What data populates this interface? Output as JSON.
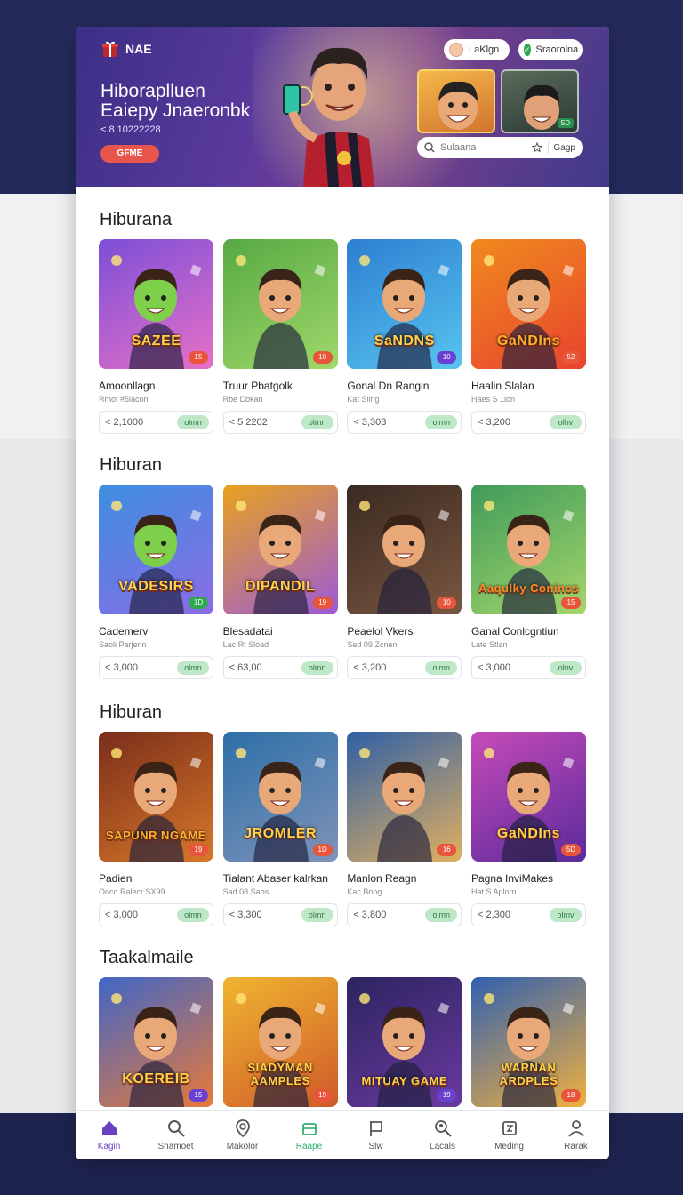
{
  "header": {
    "brand_name": "NAE",
    "title_line1": "Hiboraplluen",
    "title_line2": "Eaiepy Jnaeronbk",
    "subtitle": "< 8  10222228",
    "cta_label": "GFME",
    "login_label": "LaKlgn",
    "signup_label": "Sraorolna",
    "search_placeholder": "Sulaana",
    "search_right_label": "Gagp",
    "thumb_badge": "5D"
  },
  "sections": [
    {
      "title": "Hiburana",
      "cards": [
        {
          "title": "Amoonllagn",
          "meta": "Rmot #5lacon",
          "price": "< 2,1000",
          "chip": "olmn",
          "badge": "15",
          "art_text": "SAZEE",
          "icon": "green-monster-art"
        },
        {
          "title": "Truur Pbatgolk",
          "meta": "Rbe Dbkan",
          "price": "< 5 2202",
          "chip": "olmn",
          "badge": "10",
          "art_text": "",
          "icon": "friends-park-art"
        },
        {
          "title": "Gonal Dn Rangin",
          "meta": "Kat Sling",
          "price": "< 3,303",
          "chip": "olmn",
          "badge": "10",
          "art_text": "SaNDNS",
          "icon": "boy-hero-art"
        },
        {
          "title": "Haalin Slalan",
          "meta": "Haes S 1lon",
          "price": "< 3,200",
          "chip": "olhv",
          "badge": "52",
          "art_text": "GaNDIns",
          "icon": "guitar-boy-art"
        }
      ]
    },
    {
      "title": "Hiburan",
      "cards": [
        {
          "title": "Cademerv",
          "meta": "Saoli Parjenn",
          "price": "< 3,000",
          "chip": "olmn",
          "badge": "1D",
          "art_text": "VADESIRS",
          "icon": "boy-monster-art"
        },
        {
          "title": "Blesadatai",
          "meta": "Lac Rt Sload",
          "price": "< 63,00",
          "chip": "olmn",
          "badge": "19",
          "art_text": "DIPANDIL",
          "icon": "party-dragon-art"
        },
        {
          "title": "Peaelol Vkers",
          "meta": "Sed 09 Zcnen",
          "price": "< 3,200",
          "chip": "olmn",
          "badge": "10",
          "art_text": "",
          "icon": "girl-portrait-art"
        },
        {
          "title": "Ganal Conlcgntiun",
          "meta": "Late Stlan",
          "price": "< 3,000",
          "chip": "olnv",
          "badge": "15",
          "art_text": "Aaqulky Conincs",
          "icon": "red-car-art"
        }
      ]
    },
    {
      "title": "Hiburan",
      "cards": [
        {
          "title": "Padien",
          "meta": "Ooco Ralecr SX99",
          "price": "< 3,000",
          "chip": "olmn",
          "badge": "19",
          "art_text": "SAPUNR NGAME",
          "icon": "group-stage-art"
        },
        {
          "title": "Tialant Abaser kalrkan",
          "meta": "Sad 08 Saos",
          "price": "< 3,300",
          "chip": "olmn",
          "badge": "1D",
          "art_text": "JROMLER",
          "icon": "skater-art"
        },
        {
          "title": "Manlon Reagn",
          "meta": "Kac Boog",
          "price": "< 3,800",
          "chip": "olmn",
          "badge": "16",
          "art_text": "",
          "icon": "guitarist-art"
        },
        {
          "title": "Pagna InviMakes",
          "meta": "Hat S Aplorn",
          "price": "< 2,300",
          "chip": "olmv",
          "badge": "5D",
          "art_text": "GaNDIns",
          "icon": "rocker-boy-art"
        }
      ]
    },
    {
      "title": "Taakalmaile",
      "cards": [
        {
          "title": "",
          "meta": "",
          "price": "",
          "chip": "",
          "badge": "15",
          "art_text": "KOEREIB",
          "icon": "friends-gang-art"
        },
        {
          "title": "",
          "meta": "",
          "price": "",
          "chip": "",
          "badge": "19",
          "art_text": "SIADYMAN AAMPLES",
          "icon": "cool-boy-art"
        },
        {
          "title": "",
          "meta": "",
          "price": "",
          "chip": "",
          "badge": "19",
          "art_text": "MITUAY GAME",
          "icon": "crowd-show-art"
        },
        {
          "title": "",
          "meta": "",
          "price": "",
          "chip": "",
          "badge": "18",
          "art_text": "WARNAN ARDPLES",
          "icon": "kids-run-art"
        }
      ]
    }
  ],
  "nav": [
    {
      "label": "Kagin",
      "icon": "home-icon"
    },
    {
      "label": "Snamoet",
      "icon": "search-icon"
    },
    {
      "label": "Makolor",
      "icon": "user-pin-icon"
    },
    {
      "label": "Raape",
      "icon": "box-icon"
    },
    {
      "label": "Slw",
      "icon": "flag-icon"
    },
    {
      "label": "Lacals",
      "icon": "magnify-person-icon"
    },
    {
      "label": "Meding",
      "icon": "tile-icon"
    },
    {
      "label": "Rarak",
      "icon": "profile-icon"
    }
  ],
  "colors": {
    "hero_bg": "#3b2f86",
    "accent_red": "#e8554c",
    "chip_green": "#bfe8c8",
    "nav_active": "#6a3fc4"
  }
}
